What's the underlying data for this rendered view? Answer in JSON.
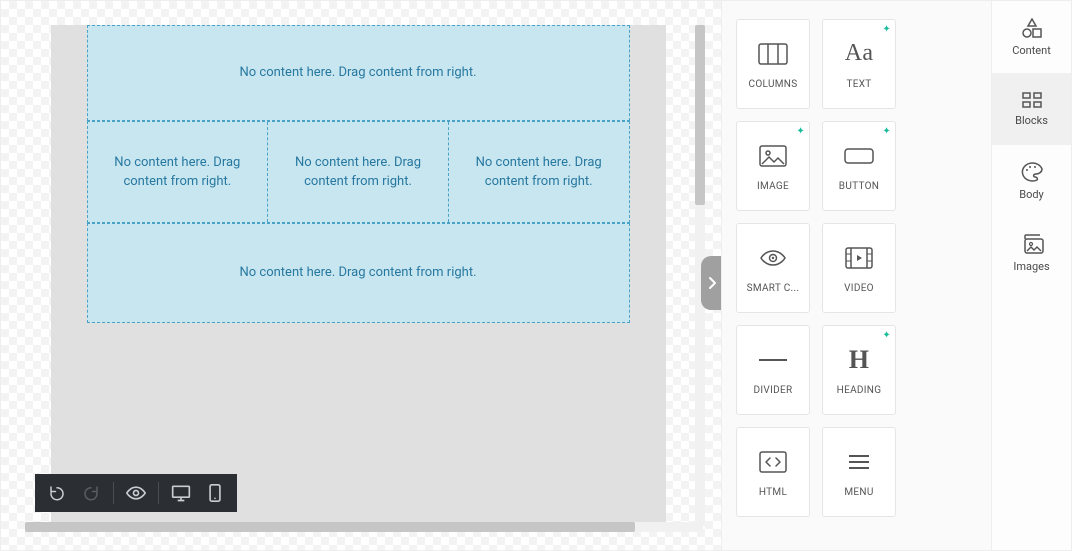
{
  "canvas": {
    "placeholder_full": "No content here. Drag content from right.",
    "placeholder_wrap": "No content here. Drag content from right."
  },
  "tiles": {
    "columns": "COLUMNS",
    "text": "TEXT",
    "image": "IMAGE",
    "button": "BUTTON",
    "smart": "SMART C...",
    "video": "VIDEO",
    "divider": "DIVIDER",
    "heading": "HEADING",
    "html": "HTML",
    "menu": "MENU"
  },
  "tabs": {
    "content": "Content",
    "blocks": "Blocks",
    "body": "Body",
    "images": "Images"
  }
}
